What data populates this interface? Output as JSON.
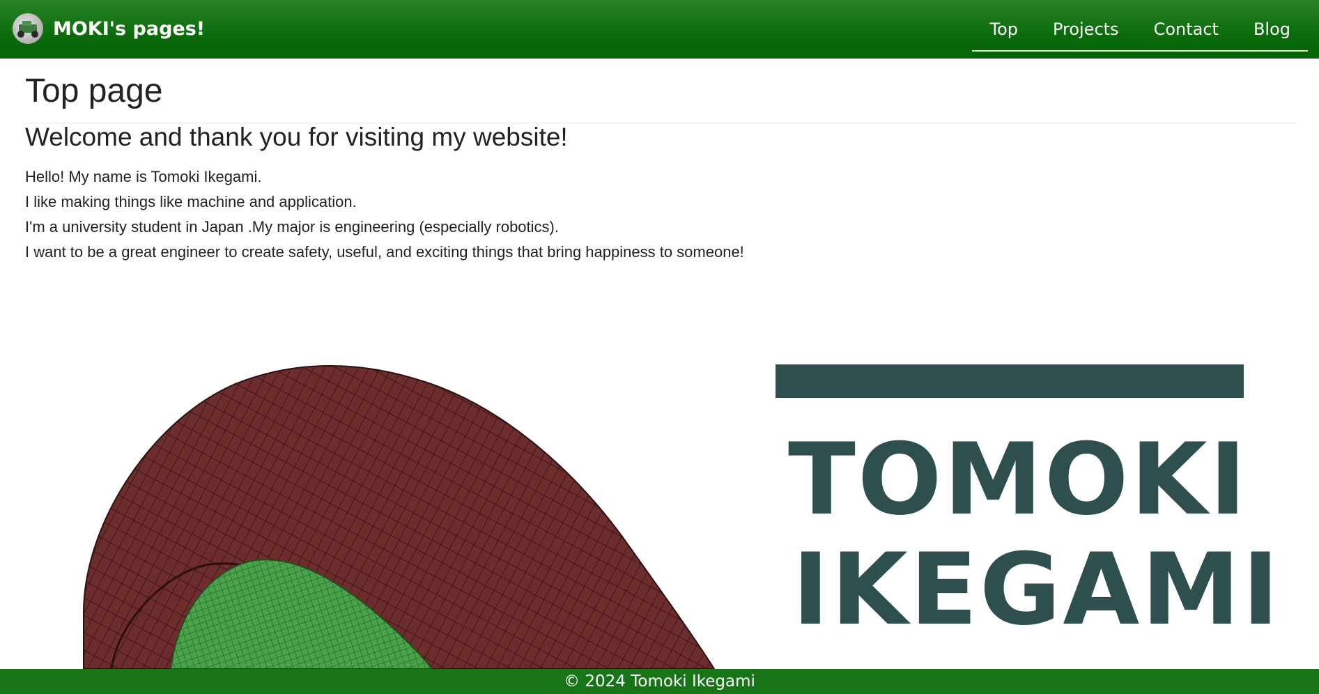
{
  "brand": {
    "name": "MOKI's pages!",
    "logo_icon": "robot-car-logo-icon"
  },
  "nav": {
    "items": [
      "Top",
      "Projects",
      "Contact",
      "Blog"
    ]
  },
  "main": {
    "title": "Top page",
    "subtitle": "Welcome and thank you for visiting my website!",
    "intro_lines": [
      "Hello! My name is Tomoki Ikegami.",
      "I like making things like machine and application.",
      "I'm a university student in Japan .My major is engineering (especially robotics).",
      "I want to be a great engineer to create safety, useful, and exciting things that bring happiness to someone!"
    ]
  },
  "hero": {
    "name_line_1": "TOMOKI",
    "name_line_2": "IKEGAMI",
    "name_color": "#2f4f4f",
    "image_icon": "tire-mesh-illustration"
  },
  "footer": {
    "copyright": "© 2024 Tomoki Ikegami"
  },
  "colors": {
    "nav_green": "#0b6b0b",
    "footer_green": "#177417",
    "tire_red": "#6e2d2d",
    "rim_green": "#4aa24a"
  }
}
